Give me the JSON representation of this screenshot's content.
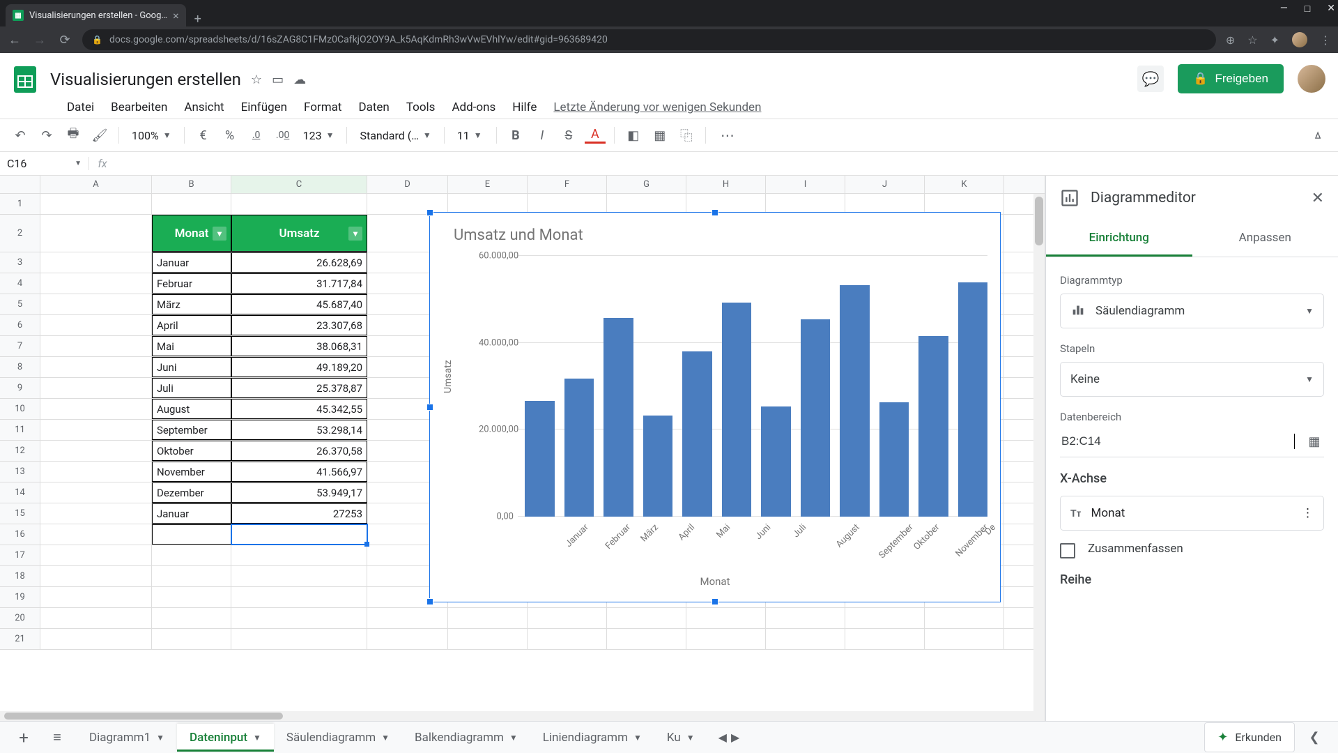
{
  "browser": {
    "tab_title": "Visualisierungen erstellen - Goog…",
    "url": "docs.google.com/spreadsheets/d/16sZAG8C1FMz0CafkjO2OY9A_k5AqKdmRh3wVwEVhlYw/edit#gid=963689420"
  },
  "doc": {
    "title": "Visualisierungen erstellen",
    "last_edit": "Letzte Änderung vor wenigen Sekunden",
    "share": "Freigeben"
  },
  "menu": [
    "Datei",
    "Bearbeiten",
    "Ansicht",
    "Einfügen",
    "Format",
    "Daten",
    "Tools",
    "Add-ons",
    "Hilfe"
  ],
  "toolbar": {
    "zoom": "100%",
    "font": "Standard (…",
    "size": "11",
    "currency": "€",
    "percent": "%",
    "dec_less": ".0",
    "dec_more": ".00",
    "fmt": "123"
  },
  "namebox": "C16",
  "columns": [
    "A",
    "B",
    "C",
    "D",
    "E",
    "F",
    "G",
    "H",
    "I",
    "J",
    "K"
  ],
  "rownums": [
    "1",
    "2",
    "3",
    "4",
    "5",
    "6",
    "7",
    "8",
    "9",
    "10",
    "11",
    "12",
    "13",
    "14",
    "15",
    "16",
    "17",
    "18",
    "19",
    "20",
    "21"
  ],
  "table": {
    "header_month": "Monat",
    "header_value": "Umsatz",
    "rows": [
      {
        "m": "Januar",
        "v": "26.628,69"
      },
      {
        "m": "Februar",
        "v": "31.717,84"
      },
      {
        "m": "März",
        "v": "45.687,40"
      },
      {
        "m": "April",
        "v": "23.307,68"
      },
      {
        "m": "Mai",
        "v": "38.068,31"
      },
      {
        "m": "Juni",
        "v": "49.189,20"
      },
      {
        "m": "Juli",
        "v": "25.378,87"
      },
      {
        "m": "August",
        "v": "45.342,55"
      },
      {
        "m": "September",
        "v": "53.298,14"
      },
      {
        "m": "Oktober",
        "v": "26.370,58"
      },
      {
        "m": "November",
        "v": "41.566,97"
      },
      {
        "m": "Dezember",
        "v": "53.949,17"
      }
    ],
    "extra": {
      "m": "Januar",
      "v": "27253"
    }
  },
  "chart_data": {
    "type": "bar",
    "title": "Umsatz und Monat",
    "xlabel": "Monat",
    "ylabel": "Umsatz",
    "ylim": [
      0,
      60000
    ],
    "yticks": [
      "0,00",
      "20.000,00",
      "40.000,00",
      "60.000,00"
    ],
    "categories": [
      "Januar",
      "Februar",
      "März",
      "April",
      "Mai",
      "Juni",
      "Juli",
      "August",
      "September",
      "Oktober",
      "November",
      "De"
    ],
    "values": [
      26628.69,
      31717.84,
      45687.4,
      23307.68,
      38068.31,
      49189.2,
      25378.87,
      45342.55,
      53298.14,
      26370.58,
      41566.97,
      53949.17
    ]
  },
  "editor": {
    "title": "Diagrammeditor",
    "tab_setup": "Einrichtung",
    "tab_custom": "Anpassen",
    "lbl_type": "Diagrammtyp",
    "val_type": "Säulendiagramm",
    "lbl_stack": "Stapeln",
    "val_stack": "Keine",
    "lbl_range": "Datenbereich",
    "val_range": "B2:C14",
    "lbl_xaxis": "X-Achse",
    "val_xaxis": "Monat",
    "chk_agg": "Zusammenfassen",
    "lbl_series": "Reihe"
  },
  "sheets": {
    "tabs": [
      "Diagramm1",
      "Dateninput",
      "Säulendiagramm",
      "Balkendiagramm",
      "Liniendiagramm",
      "Ku"
    ],
    "active": "Dateninput",
    "explore": "Erkunden"
  }
}
